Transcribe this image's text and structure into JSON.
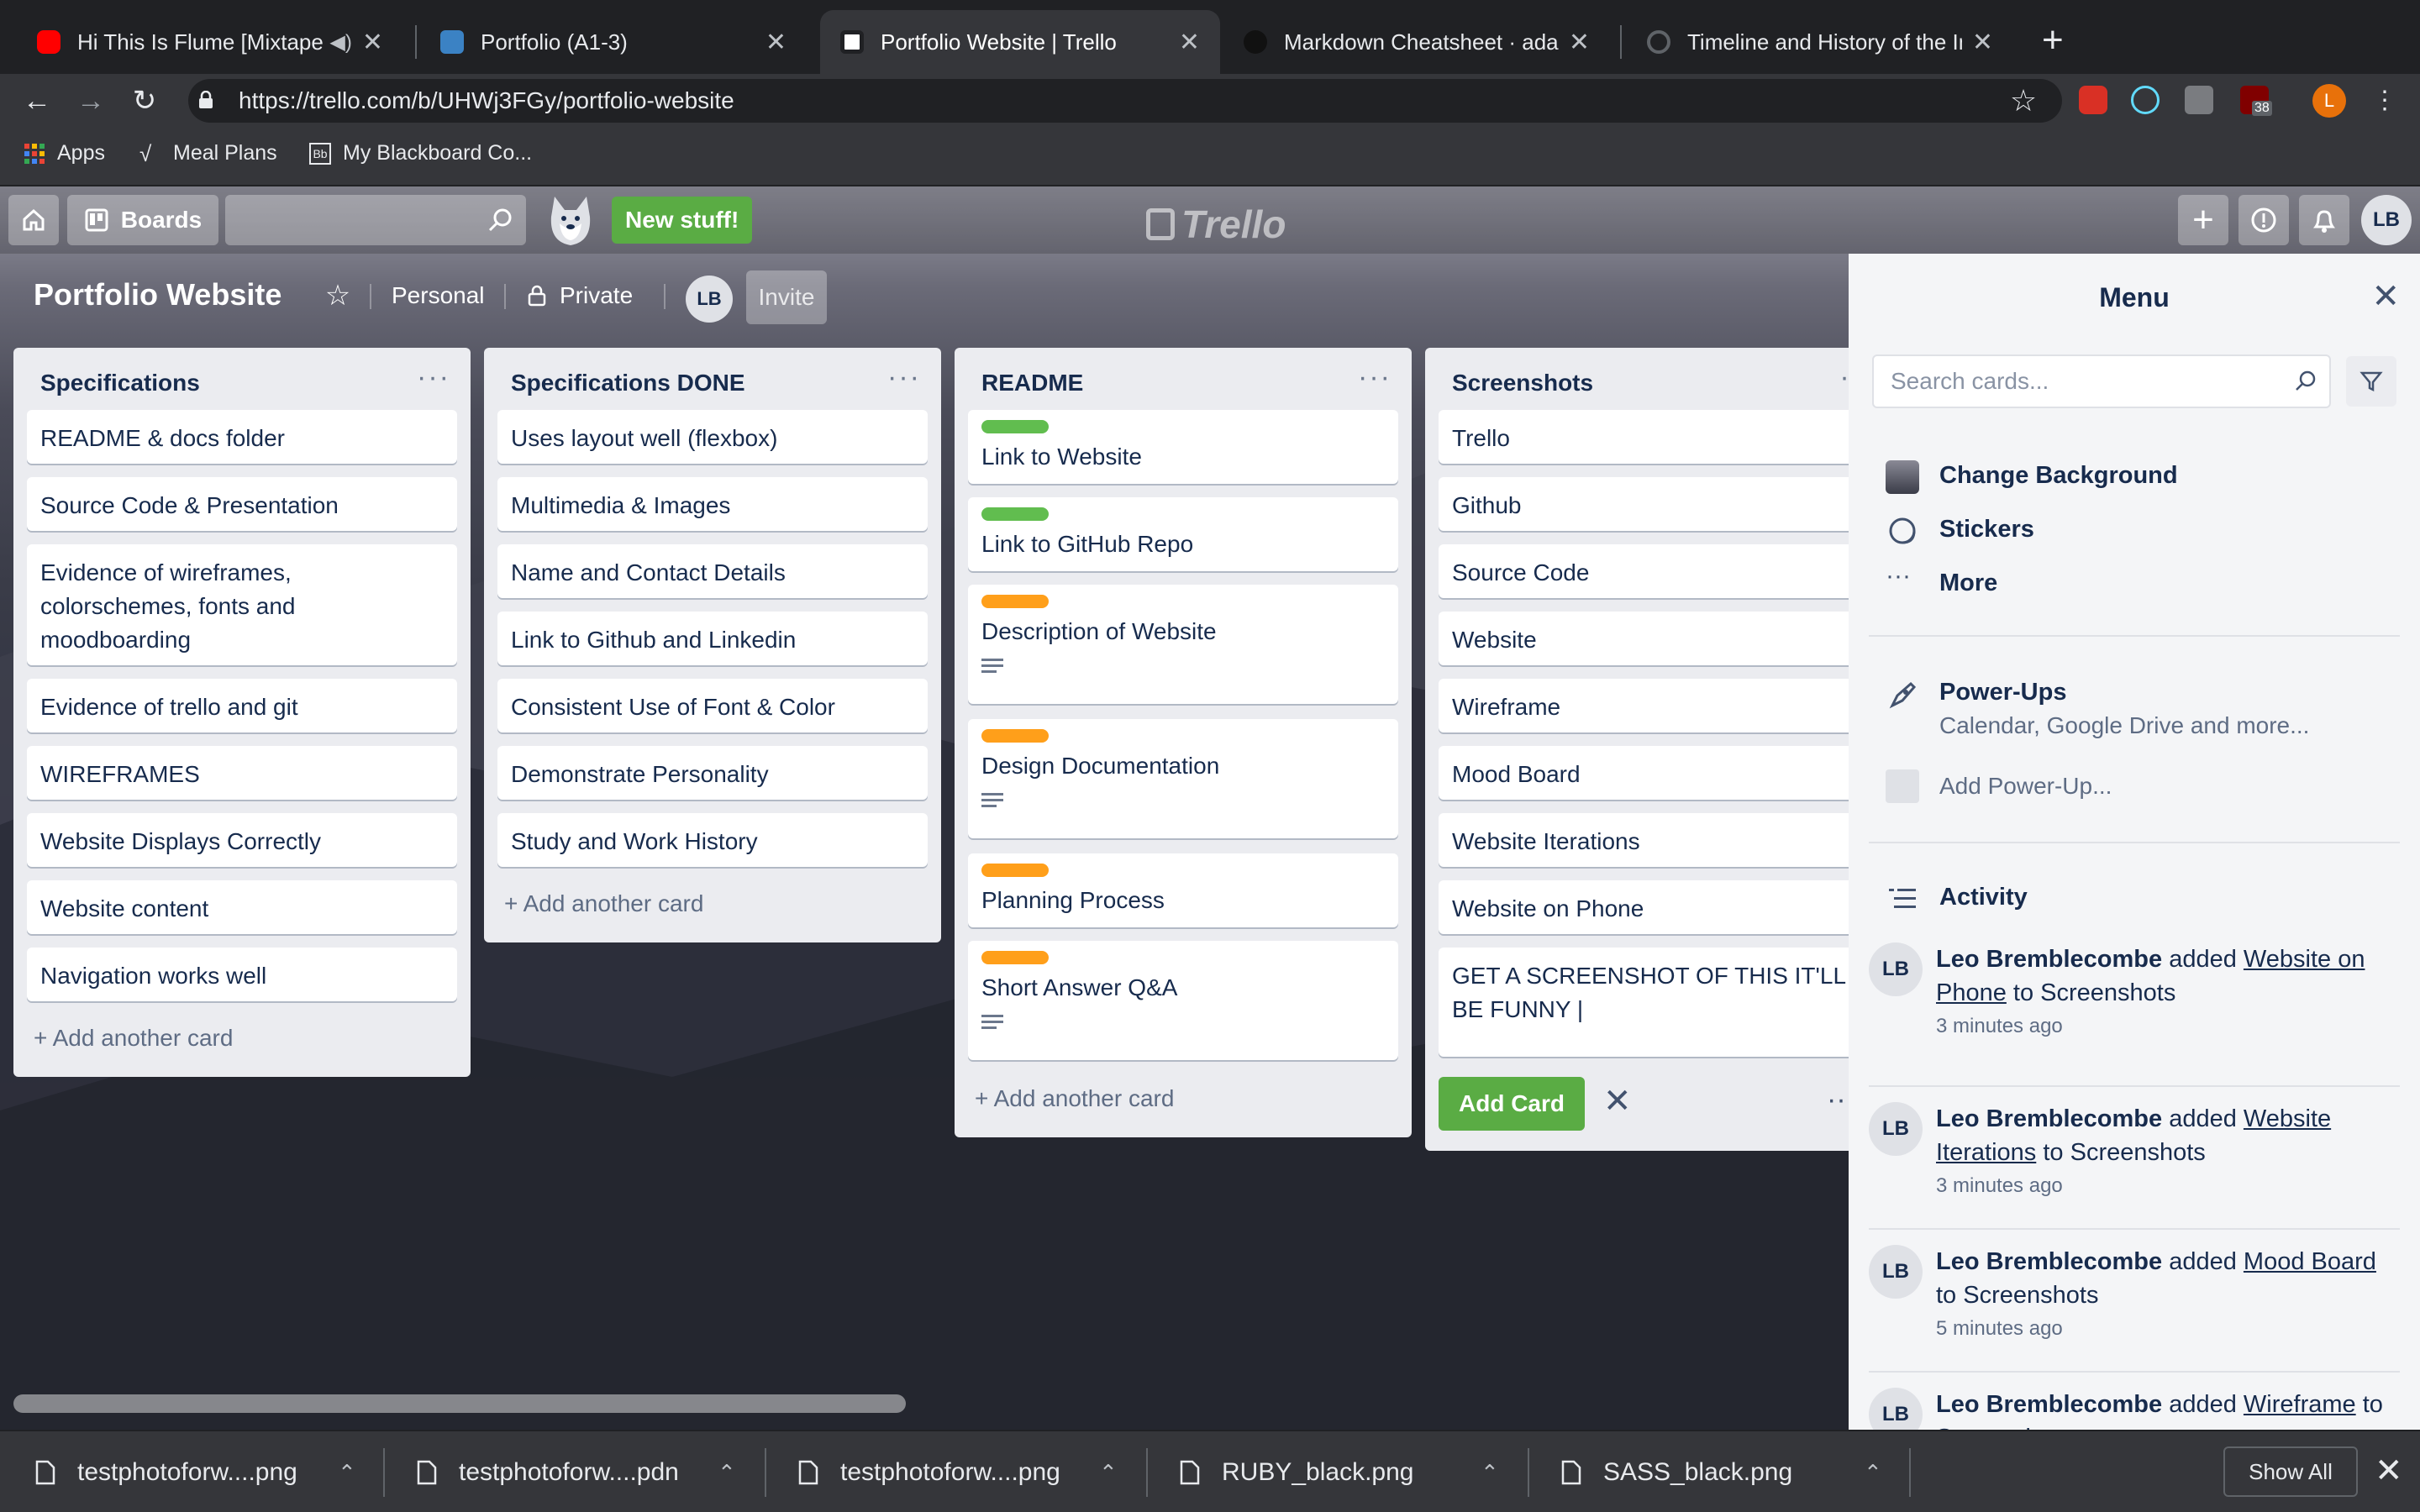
{
  "browser": {
    "tabs": [
      {
        "title": "Hi This Is Flume [Mixtape V"
      },
      {
        "title": "Portfolio (A1-3)"
      },
      {
        "title": "Portfolio Website | Trello"
      },
      {
        "title": "Markdown Cheatsheet · adam-"
      },
      {
        "title": "Timeline and History of the Inte"
      }
    ],
    "url": "https://trello.com/b/UHWj3FGy/portfolio-website",
    "bookmarks": [
      {
        "label": "Apps"
      },
      {
        "label": "Meal Plans"
      },
      {
        "label": "My Blackboard Co..."
      }
    ],
    "extension_badge": "38",
    "profile_initial": "L"
  },
  "trello": {
    "nav": {
      "boards_label": "Boards",
      "new_stuff_label": "New stuff!",
      "logo_text": "Trello",
      "user_initials": "LB"
    },
    "board": {
      "title": "Portfolio Website",
      "team_label": "Personal",
      "visibility_label": "Private",
      "member_initials": "LB",
      "invite_label": "Invite"
    },
    "lists": [
      {
        "title": "Specifications",
        "cards": [
          "README & docs folder",
          "Source Code & Presentation",
          "Evidence of wireframes, colorschemes, fonts and moodboarding",
          "Evidence of trello and git",
          "WIREFRAMES",
          "Website Displays Correctly",
          "Website content",
          "Navigation works well"
        ],
        "add_label": "Add another card"
      },
      {
        "title": "Specifications DONE",
        "cards": [
          "Uses layout well (flexbox)",
          "Multimedia & Images",
          "Name and Contact Details",
          "Link to Github and Linkedin",
          "Consistent Use of Font & Color",
          "Demonstrate Personality",
          "Study and Work History"
        ],
        "add_label": "Add another card"
      },
      {
        "title": "README",
        "cards": [
          "Link to Website",
          "Link to GitHub Repo",
          "Description of Website",
          "Design Documentation",
          "Planning Process",
          "Short Answer Q&A"
        ],
        "add_label": "Add another card"
      },
      {
        "title": "Screenshots",
        "cards": [
          "Trello",
          "Github",
          "Source Code",
          "Website",
          "Wireframe",
          "Mood Board",
          "Website Iterations",
          "Website on Phone"
        ],
        "draft_text": "GET A SCREENSHOT OF THIS IT'LL BE FUNNY |",
        "add_card_button": "Add Card"
      }
    ],
    "colors": {
      "green_label": "#61bd4f",
      "orange_label": "#ff9f1a",
      "add_button": "#5aac44"
    },
    "menu": {
      "title": "Menu",
      "search_placeholder": "Search cards...",
      "items": [
        "Change Background",
        "Stickers",
        "More"
      ],
      "powerups_title": "Power-Ups",
      "powerups_sub": "Calendar, Google Drive and more...",
      "add_powerup": "Add Power-Up...",
      "activity_title": "Activity",
      "activity": [
        {
          "initials": "LB",
          "user": "Leo Bremblecombe",
          "verb": "added",
          "card": "Website on Phone",
          "list": "to Screenshots",
          "time": "3 minutes ago"
        },
        {
          "initials": "LB",
          "user": "Leo Bremblecombe",
          "verb": "added",
          "card": "Website Iterations",
          "list": "to Screenshots",
          "time": "3 minutes ago"
        },
        {
          "initials": "LB",
          "user": "Leo Bremblecombe",
          "verb": "added",
          "card": "Mood Board",
          "list": "to Screenshots",
          "time": "5 minutes ago"
        },
        {
          "initials": "LB",
          "user": "Leo Bremblecombe",
          "verb": "added",
          "card": "Wireframe",
          "list": "to Screenshots",
          "time": ""
        }
      ]
    }
  },
  "downloads": {
    "files": [
      "testphotoforw....png",
      "testphotoforw....pdn",
      "testphotoforw....png",
      "RUBY_black.png",
      "SASS_black.png"
    ],
    "show_all": "Show All"
  }
}
